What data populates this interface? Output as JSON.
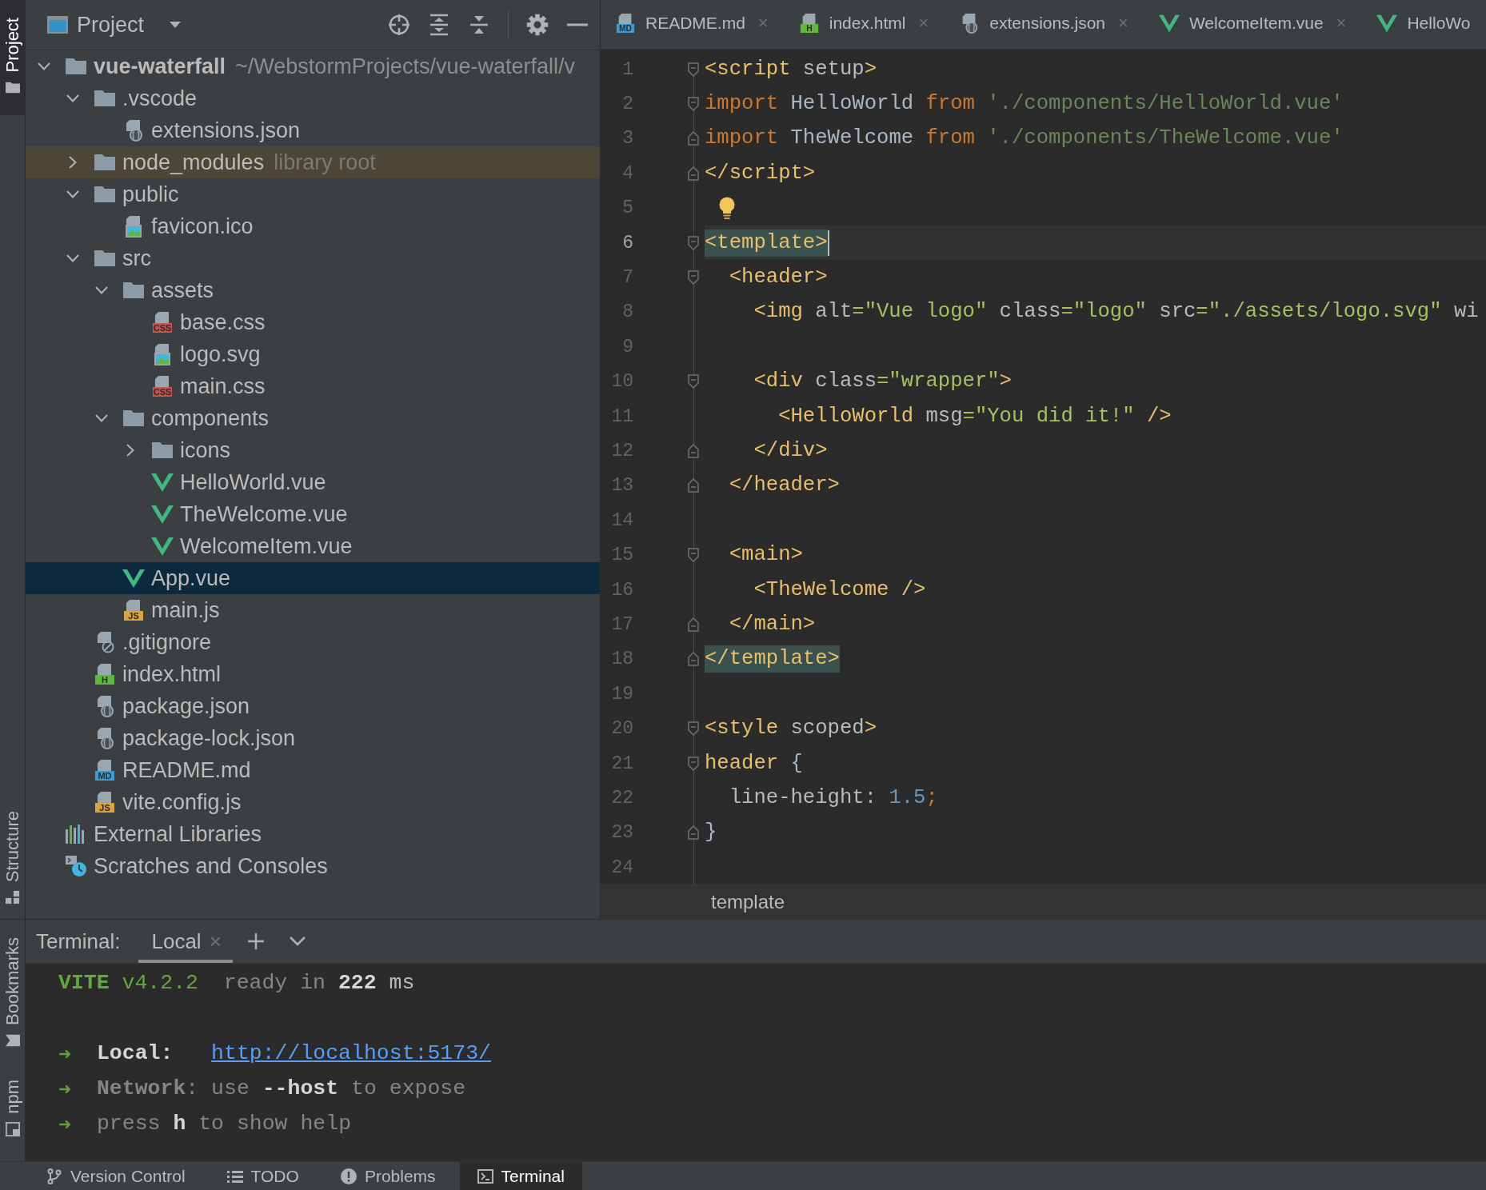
{
  "left_strip": {
    "top": [
      {
        "label": "Project",
        "kind": "project",
        "selected": true
      }
    ],
    "middle": [
      {
        "label": "Structure",
        "kind": "structure",
        "selected": false
      }
    ],
    "bottom": [
      {
        "label": "Bookmarks",
        "kind": "bookmarks",
        "selected": false
      },
      {
        "label": "npm",
        "kind": "npm",
        "selected": false
      }
    ]
  },
  "project": {
    "title": "Project",
    "tree": [
      {
        "label": "vue-waterfall",
        "path": "~/WebstormProjects/vue-waterfall/v",
        "kind": "root",
        "expanded": true,
        "selected": false,
        "children": [
          {
            "label": ".vscode",
            "kind": "folder",
            "expanded": true,
            "selected": false,
            "children": [
              {
                "label": "extensions.json",
                "kind": "json",
                "selected": false
              }
            ]
          },
          {
            "label": "node_modules",
            "note": "library root",
            "kind": "library",
            "expanded": false,
            "selected": false
          },
          {
            "label": "public",
            "kind": "folder",
            "expanded": true,
            "selected": false,
            "children": [
              {
                "label": "favicon.ico",
                "kind": "image",
                "selected": false
              }
            ]
          },
          {
            "label": "src",
            "kind": "folder",
            "expanded": true,
            "selected": false,
            "children": [
              {
                "label": "assets",
                "kind": "folder",
                "expanded": true,
                "selected": false,
                "children": [
                  {
                    "label": "base.css",
                    "kind": "css",
                    "badge": "CSS",
                    "selected": false
                  },
                  {
                    "label": "logo.svg",
                    "kind": "image",
                    "selected": false
                  },
                  {
                    "label": "main.css",
                    "kind": "css",
                    "badge": "CSS",
                    "selected": false
                  }
                ]
              },
              {
                "label": "components",
                "kind": "folder",
                "expanded": true,
                "selected": false,
                "children": [
                  {
                    "label": "icons",
                    "kind": "folder",
                    "expanded": false,
                    "selected": false
                  },
                  {
                    "label": "HelloWorld.vue",
                    "kind": "vue",
                    "selected": false
                  },
                  {
                    "label": "TheWelcome.vue",
                    "kind": "vue",
                    "selected": false
                  },
                  {
                    "label": "WelcomeItem.vue",
                    "kind": "vue",
                    "selected": false
                  }
                ]
              },
              {
                "label": "App.vue",
                "kind": "vue",
                "selected": true
              },
              {
                "label": "main.js",
                "kind": "js",
                "badge": "JS",
                "selected": false
              }
            ]
          },
          {
            "label": ".gitignore",
            "kind": "ignore",
            "selected": false
          },
          {
            "label": "index.html",
            "kind": "html",
            "badge": "H",
            "selected": false
          },
          {
            "label": "package.json",
            "kind": "json",
            "selected": false
          },
          {
            "label": "package-lock.json",
            "kind": "json",
            "selected": false
          },
          {
            "label": "README.md",
            "kind": "markdown",
            "badge": "MD",
            "selected": false
          },
          {
            "label": "vite.config.js",
            "kind": "js",
            "badge": "JS",
            "selected": false
          }
        ]
      },
      {
        "label": "External Libraries",
        "kind": "libraries",
        "selected": false
      },
      {
        "label": "Scratches and Consoles",
        "kind": "scratches",
        "selected": false
      }
    ]
  },
  "editor": {
    "tabs": [
      {
        "label": "README.md",
        "kind": "markdown",
        "badge": "MD",
        "close": "×",
        "selected": false
      },
      {
        "label": "index.html",
        "kind": "html",
        "badge": "H",
        "close": "×",
        "selected": false
      },
      {
        "label": "extensions.json",
        "kind": "json",
        "close": "×",
        "selected": false
      },
      {
        "label": "WelcomeItem.vue",
        "kind": "vue",
        "close": "×",
        "selected": false
      },
      {
        "label": "HelloWo",
        "kind": "vue",
        "selected": false
      }
    ],
    "lines": [
      {
        "n": "1",
        "kind": "open",
        "current": false,
        "tokens": [
          {
            "text": "<script",
            "kind": "tag"
          },
          {
            "text": " setup",
            "kind": "attr"
          },
          {
            "text": ">",
            "kind": "tag"
          }
        ]
      },
      {
        "n": "2",
        "kind": "open",
        "current": false,
        "tokens": [
          {
            "text": "import",
            "kind": "keyword"
          },
          {
            "text": " HelloWorld ",
            "kind": "ident"
          },
          {
            "text": "from",
            "kind": "keyword"
          },
          {
            "text": " './components/HelloWorld.vue'",
            "kind": "string"
          }
        ]
      },
      {
        "n": "3",
        "kind": "close",
        "current": false,
        "tokens": [
          {
            "text": "import",
            "kind": "keyword"
          },
          {
            "text": " TheWelcome ",
            "kind": "ident"
          },
          {
            "text": "from",
            "kind": "keyword"
          },
          {
            "text": " './components/TheWelcome.vue'",
            "kind": "string"
          }
        ]
      },
      {
        "n": "4",
        "kind": "close",
        "current": false,
        "tokens": [
          {
            "text": "</script>",
            "kind": "tag"
          }
        ]
      },
      {
        "n": "5",
        "kind": "plain",
        "current": false,
        "bulb": true
      },
      {
        "n": "6",
        "kind": "open",
        "current": true,
        "matched": true,
        "tokens": [
          {
            "text": "<template>",
            "kind": "tag"
          }
        ]
      },
      {
        "n": "7",
        "kind": "open",
        "current": false,
        "tokens": [
          {
            "text": "  <header>",
            "kind": "tag"
          }
        ]
      },
      {
        "n": "8",
        "kind": "plain",
        "current": false,
        "tokens": [
          {
            "text": "    <img",
            "kind": "tag"
          },
          {
            "text": " alt",
            "kind": "attr"
          },
          {
            "text": "=\"Vue logo\"",
            "kind": "value"
          },
          {
            "text": " class",
            "kind": "attr"
          },
          {
            "text": "=\"logo\"",
            "kind": "value"
          },
          {
            "text": " src",
            "kind": "attr"
          },
          {
            "text": "=\"./assets/logo.svg\"",
            "kind": "value"
          },
          {
            "text": " wi",
            "kind": "attr"
          }
        ]
      },
      {
        "n": "9",
        "kind": "plain",
        "current": false
      },
      {
        "n": "10",
        "kind": "open",
        "current": false,
        "tokens": [
          {
            "text": "    <div",
            "kind": "tag"
          },
          {
            "text": " class",
            "kind": "attr"
          },
          {
            "text": "=\"wrapper\"",
            "kind": "value"
          },
          {
            "text": ">",
            "kind": "tag"
          }
        ]
      },
      {
        "n": "11",
        "kind": "plain",
        "current": false,
        "tokens": [
          {
            "text": "      <HelloWorld",
            "kind": "tag"
          },
          {
            "text": " msg",
            "kind": "attr"
          },
          {
            "text": "=\"You did it!\"",
            "kind": "value"
          },
          {
            "text": " />",
            "kind": "tag"
          }
        ]
      },
      {
        "n": "12",
        "kind": "close",
        "current": false,
        "tokens": [
          {
            "text": "    </div>",
            "kind": "tag"
          }
        ]
      },
      {
        "n": "13",
        "kind": "close",
        "current": false,
        "tokens": [
          {
            "text": "  </header>",
            "kind": "tag"
          }
        ]
      },
      {
        "n": "14",
        "kind": "plain",
        "current": false
      },
      {
        "n": "15",
        "kind": "open",
        "current": false,
        "tokens": [
          {
            "text": "  <main>",
            "kind": "tag"
          }
        ]
      },
      {
        "n": "16",
        "kind": "plain",
        "current": false,
        "tokens": [
          {
            "text": "    <TheWelcome />",
            "kind": "tag"
          }
        ]
      },
      {
        "n": "17",
        "kind": "close",
        "current": false,
        "tokens": [
          {
            "text": "  </main>",
            "kind": "tag"
          }
        ]
      },
      {
        "n": "18",
        "kind": "close",
        "current": false,
        "matched": true,
        "tokens": [
          {
            "text": "</template>",
            "kind": "tag"
          }
        ]
      },
      {
        "n": "19",
        "kind": "plain",
        "current": false
      },
      {
        "n": "20",
        "kind": "open",
        "current": false,
        "tokens": [
          {
            "text": "<style",
            "kind": "tag"
          },
          {
            "text": " scoped",
            "kind": "attr"
          },
          {
            "text": ">",
            "kind": "tag"
          }
        ]
      },
      {
        "n": "21",
        "kind": "open",
        "current": false,
        "tokens": [
          {
            "text": "header",
            "kind": "tag"
          },
          {
            "text": " {",
            "kind": "plain"
          }
        ]
      },
      {
        "n": "22",
        "kind": "plain",
        "current": false,
        "tokens": [
          {
            "text": "  line-height",
            "kind": "attr"
          },
          {
            "text": ": ",
            "kind": "plain"
          },
          {
            "text": "1.5",
            "kind": "number"
          },
          {
            "text": ";",
            "kind": "keyword"
          }
        ]
      },
      {
        "n": "23",
        "kind": "close",
        "current": false,
        "tokens": [
          {
            "text": "}",
            "kind": "plain"
          }
        ]
      },
      {
        "n": "24",
        "kind": "plain",
        "current": false
      }
    ],
    "breadcrumb": "template"
  },
  "terminal": {
    "title": "Terminal:",
    "tabs": [
      {
        "label": "Local",
        "close": "×",
        "selected": true
      }
    ],
    "lines": [
      {
        "kind": "output",
        "parts": [
          {
            "text": "VITE",
            "kind": "brand-bold"
          },
          {
            "text": " v4.2.2",
            "kind": "brand"
          },
          {
            "text": "  ready in ",
            "kind": "dim"
          },
          {
            "text": "222",
            "kind": "strong"
          },
          {
            "text": " ms",
            "kind": "plain"
          }
        ]
      },
      {
        "kind": "blank"
      },
      {
        "kind": "bullet",
        "arrow": "➜",
        "parts": [
          {
            "text": "Local:",
            "kind": "strong"
          }
        ],
        "link": "http://localhost:5173/"
      },
      {
        "kind": "bullet",
        "arrow": "➜",
        "parts": [
          {
            "text": "Network",
            "kind": "dim-bold"
          },
          {
            "text": ": use ",
            "kind": "dim"
          },
          {
            "text": "--host",
            "kind": "strong"
          },
          {
            "text": " to expose",
            "kind": "dim"
          }
        ]
      },
      {
        "kind": "bullet",
        "arrow": "➜",
        "parts": [
          {
            "text": "press ",
            "kind": "dim"
          },
          {
            "text": "h",
            "kind": "strong"
          },
          {
            "text": " to show help",
            "kind": "dim"
          }
        ]
      }
    ]
  },
  "bottom_bar": {
    "items": [
      {
        "label": "Version Control",
        "kind": "vcs",
        "selected": false
      },
      {
        "label": "TODO",
        "kind": "todo",
        "selected": false
      },
      {
        "label": "Problems",
        "kind": "problems",
        "selected": false
      },
      {
        "label": "Terminal",
        "kind": "terminal",
        "selected": true
      }
    ]
  }
}
